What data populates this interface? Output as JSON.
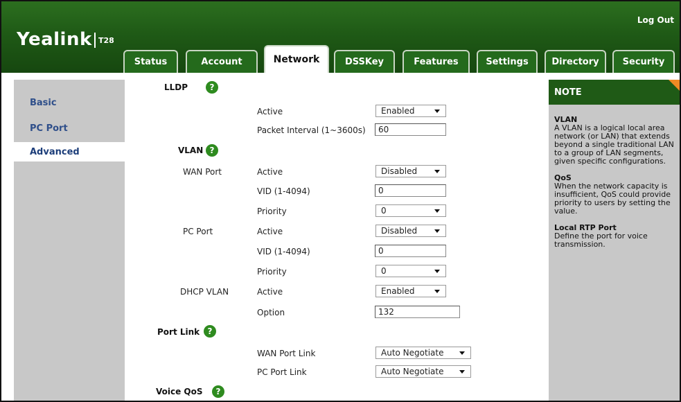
{
  "header": {
    "logo": "Yealink",
    "model": "T28",
    "logout": "Log Out"
  },
  "tabs": [
    "Status",
    "Account",
    "Network",
    "DSSKey",
    "Features",
    "Settings",
    "Directory",
    "Security"
  ],
  "active_tab": "Network",
  "sidebar": {
    "items": [
      "Basic",
      "PC Port",
      "Advanced"
    ],
    "active": "Advanced"
  },
  "lldp": {
    "title": "LLDP",
    "active_label": "Active",
    "active_value": "Enabled",
    "interval_label": "Packet Interval (1~3600s)",
    "interval_value": "60"
  },
  "vlan": {
    "title": "VLAN",
    "wan": {
      "label": "WAN Port",
      "active_label": "Active",
      "active_value": "Disabled",
      "vid_label": "VID (1-4094)",
      "vid_value": "0",
      "priority_label": "Priority",
      "priority_value": "0"
    },
    "pc": {
      "label": "PC Port",
      "active_label": "Active",
      "active_value": "Disabled",
      "vid_label": "VID (1-4094)",
      "vid_value": "0",
      "priority_label": "Priority",
      "priority_value": "0"
    },
    "dhcp": {
      "label": "DHCP VLAN",
      "active_label": "Active",
      "active_value": "Enabled",
      "option_label": "Option",
      "option_value": "132"
    }
  },
  "port_link": {
    "title": "Port Link",
    "wan_label": "WAN Port Link",
    "wan_value": "Auto Negotiate",
    "pc_label": "PC Port Link",
    "pc_value": "Auto Negotiate"
  },
  "voice_qos": {
    "title": "Voice QoS"
  },
  "help_glyph": "?",
  "note": {
    "title": "NOTE",
    "sections": [
      {
        "heading": "VLAN",
        "text": "A VLAN is a logical local area network (or LAN) that extends beyond a single traditional LAN to a group of LAN segments, given specific configurations."
      },
      {
        "heading": "QoS",
        "text": "When the network capacity is insufficient, QoS could provide priority to users by setting the value."
      },
      {
        "heading": "Local RTP Port",
        "text": "Define the port for voice transmission."
      }
    ]
  },
  "colors": {
    "header_green": "#1f5a16",
    "help_green": "#2e8b1f",
    "sidebar_gray": "#c8c8c8",
    "note_corner": "#f08a24",
    "link_blue": "#2f4f8a"
  }
}
